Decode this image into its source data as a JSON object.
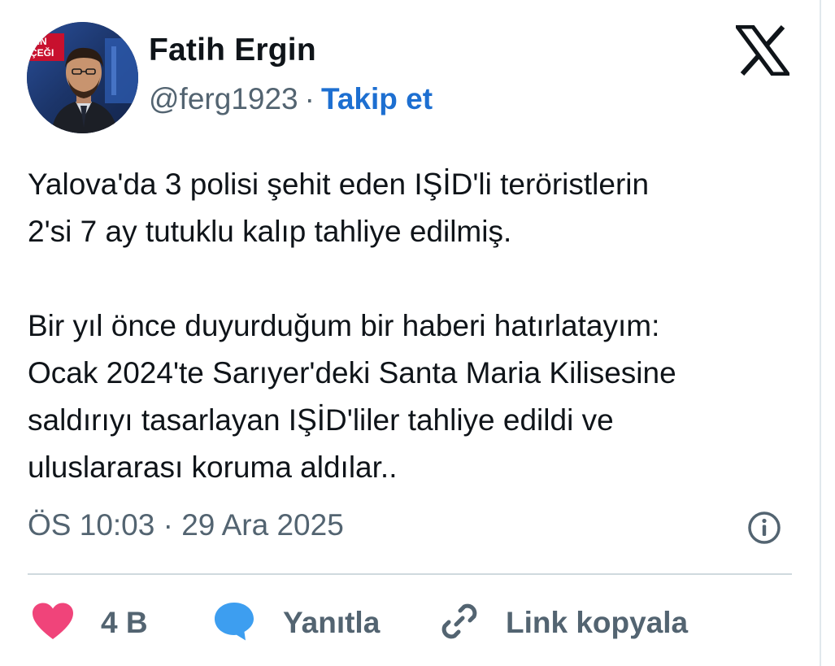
{
  "author": {
    "display_name": "Fatih Ergin",
    "handle": "@ferg1923",
    "separator": "·",
    "follow_label": "Takip et",
    "avatar_overlay_text": "NIN ÇEĞI"
  },
  "tweet": {
    "text": "Yalova'da 3 polisi şehit eden IŞİD'li teröristlerin\n2'si 7 ay tutuklu kalıp tahliye edilmiş.\n\nBir yıl önce duyurduğum bir haberi hatırlatayım:\nOcak 2024'te Sarıyer'deki Santa Maria Kilisesine\nsaldırıyı tasarlayan IŞİD'liler tahliye edildi ve\nuluslararası koruma aldılar..",
    "timestamp": "ÖS 10:03 · 29 Ara 2025"
  },
  "actions": {
    "like_count": "4 B",
    "reply_label": "Yanıtla",
    "copy_link_label": "Link kopyala"
  },
  "icons": {
    "brand": "x-logo-icon",
    "info": "info-icon",
    "like": "heart-icon",
    "reply": "speech-bubble-icon",
    "link": "link-icon"
  },
  "colors": {
    "text": "#0f1419",
    "secondary": "#536471",
    "follow": "#1d6fd1",
    "heart": "#f0447a",
    "reply_bubble": "#3d9ef0",
    "divider": "#cfd9de"
  }
}
